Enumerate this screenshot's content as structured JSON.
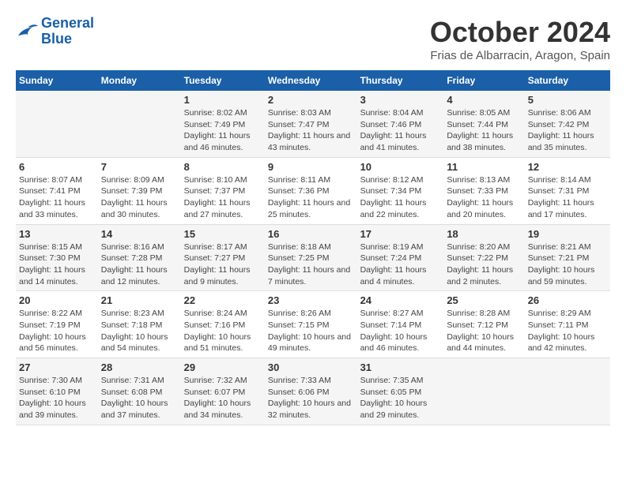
{
  "header": {
    "logo_line1": "General",
    "logo_line2": "Blue",
    "month_title": "October 2024",
    "location": "Frias de Albarracin, Aragon, Spain"
  },
  "columns": [
    "Sunday",
    "Monday",
    "Tuesday",
    "Wednesday",
    "Thursday",
    "Friday",
    "Saturday"
  ],
  "weeks": [
    [
      {
        "day": "",
        "info": ""
      },
      {
        "day": "",
        "info": ""
      },
      {
        "day": "1",
        "info": "Sunrise: 8:02 AM\nSunset: 7:49 PM\nDaylight: 11 hours and 46 minutes."
      },
      {
        "day": "2",
        "info": "Sunrise: 8:03 AM\nSunset: 7:47 PM\nDaylight: 11 hours and 43 minutes."
      },
      {
        "day": "3",
        "info": "Sunrise: 8:04 AM\nSunset: 7:46 PM\nDaylight: 11 hours and 41 minutes."
      },
      {
        "day": "4",
        "info": "Sunrise: 8:05 AM\nSunset: 7:44 PM\nDaylight: 11 hours and 38 minutes."
      },
      {
        "day": "5",
        "info": "Sunrise: 8:06 AM\nSunset: 7:42 PM\nDaylight: 11 hours and 35 minutes."
      }
    ],
    [
      {
        "day": "6",
        "info": "Sunrise: 8:07 AM\nSunset: 7:41 PM\nDaylight: 11 hours and 33 minutes."
      },
      {
        "day": "7",
        "info": "Sunrise: 8:09 AM\nSunset: 7:39 PM\nDaylight: 11 hours and 30 minutes."
      },
      {
        "day": "8",
        "info": "Sunrise: 8:10 AM\nSunset: 7:37 PM\nDaylight: 11 hours and 27 minutes."
      },
      {
        "day": "9",
        "info": "Sunrise: 8:11 AM\nSunset: 7:36 PM\nDaylight: 11 hours and 25 minutes."
      },
      {
        "day": "10",
        "info": "Sunrise: 8:12 AM\nSunset: 7:34 PM\nDaylight: 11 hours and 22 minutes."
      },
      {
        "day": "11",
        "info": "Sunrise: 8:13 AM\nSunset: 7:33 PM\nDaylight: 11 hours and 20 minutes."
      },
      {
        "day": "12",
        "info": "Sunrise: 8:14 AM\nSunset: 7:31 PM\nDaylight: 11 hours and 17 minutes."
      }
    ],
    [
      {
        "day": "13",
        "info": "Sunrise: 8:15 AM\nSunset: 7:30 PM\nDaylight: 11 hours and 14 minutes."
      },
      {
        "day": "14",
        "info": "Sunrise: 8:16 AM\nSunset: 7:28 PM\nDaylight: 11 hours and 12 minutes."
      },
      {
        "day": "15",
        "info": "Sunrise: 8:17 AM\nSunset: 7:27 PM\nDaylight: 11 hours and 9 minutes."
      },
      {
        "day": "16",
        "info": "Sunrise: 8:18 AM\nSunset: 7:25 PM\nDaylight: 11 hours and 7 minutes."
      },
      {
        "day": "17",
        "info": "Sunrise: 8:19 AM\nSunset: 7:24 PM\nDaylight: 11 hours and 4 minutes."
      },
      {
        "day": "18",
        "info": "Sunrise: 8:20 AM\nSunset: 7:22 PM\nDaylight: 11 hours and 2 minutes."
      },
      {
        "day": "19",
        "info": "Sunrise: 8:21 AM\nSunset: 7:21 PM\nDaylight: 10 hours and 59 minutes."
      }
    ],
    [
      {
        "day": "20",
        "info": "Sunrise: 8:22 AM\nSunset: 7:19 PM\nDaylight: 10 hours and 56 minutes."
      },
      {
        "day": "21",
        "info": "Sunrise: 8:23 AM\nSunset: 7:18 PM\nDaylight: 10 hours and 54 minutes."
      },
      {
        "day": "22",
        "info": "Sunrise: 8:24 AM\nSunset: 7:16 PM\nDaylight: 10 hours and 51 minutes."
      },
      {
        "day": "23",
        "info": "Sunrise: 8:26 AM\nSunset: 7:15 PM\nDaylight: 10 hours and 49 minutes."
      },
      {
        "day": "24",
        "info": "Sunrise: 8:27 AM\nSunset: 7:14 PM\nDaylight: 10 hours and 46 minutes."
      },
      {
        "day": "25",
        "info": "Sunrise: 8:28 AM\nSunset: 7:12 PM\nDaylight: 10 hours and 44 minutes."
      },
      {
        "day": "26",
        "info": "Sunrise: 8:29 AM\nSunset: 7:11 PM\nDaylight: 10 hours and 42 minutes."
      }
    ],
    [
      {
        "day": "27",
        "info": "Sunrise: 7:30 AM\nSunset: 6:10 PM\nDaylight: 10 hours and 39 minutes."
      },
      {
        "day": "28",
        "info": "Sunrise: 7:31 AM\nSunset: 6:08 PM\nDaylight: 10 hours and 37 minutes."
      },
      {
        "day": "29",
        "info": "Sunrise: 7:32 AM\nSunset: 6:07 PM\nDaylight: 10 hours and 34 minutes."
      },
      {
        "day": "30",
        "info": "Sunrise: 7:33 AM\nSunset: 6:06 PM\nDaylight: 10 hours and 32 minutes."
      },
      {
        "day": "31",
        "info": "Sunrise: 7:35 AM\nSunset: 6:05 PM\nDaylight: 10 hours and 29 minutes."
      },
      {
        "day": "",
        "info": ""
      },
      {
        "day": "",
        "info": ""
      }
    ]
  ]
}
